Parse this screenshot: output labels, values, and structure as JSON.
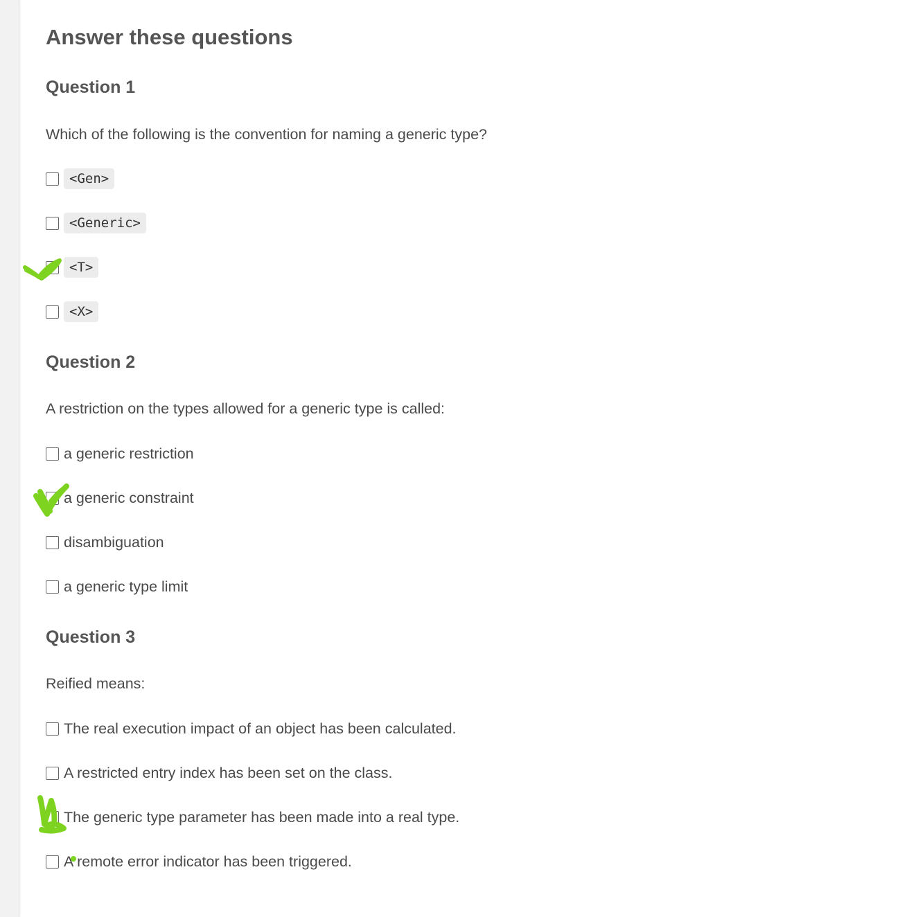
{
  "page": {
    "title": "Answer these questions"
  },
  "questions": [
    {
      "heading": "Question 1",
      "text": "Which of the following is the convention for naming a generic type?",
      "options": [
        {
          "label": "<Gen>",
          "style": "code",
          "checked": false
        },
        {
          "label": "<Generic>",
          "style": "code",
          "checked": false
        },
        {
          "label": "<T>",
          "style": "code",
          "checked": false
        },
        {
          "label": "<X>",
          "style": "code",
          "checked": false
        }
      ]
    },
    {
      "heading": "Question 2",
      "text": "A restriction on the types allowed for a generic type is called:",
      "options": [
        {
          "label": "a generic restriction",
          "style": "text",
          "checked": false
        },
        {
          "label": "a generic constraint",
          "style": "text",
          "checked": false
        },
        {
          "label": "disambiguation",
          "style": "text",
          "checked": false
        },
        {
          "label": "a generic type limit",
          "style": "text",
          "checked": false
        }
      ]
    },
    {
      "heading": "Question 3",
      "text": "Reified means:",
      "options": [
        {
          "label": "The real execution impact of an object has been calculated.",
          "style": "text",
          "checked": false
        },
        {
          "label": "A restricted entry index has been set on the class.",
          "style": "text",
          "checked": false
        },
        {
          "label": "The generic type parameter has been made into a real type.",
          "style": "text",
          "checked": false
        },
        {
          "label": "A remote error indicator has been triggered.",
          "style": "text",
          "checked": false
        }
      ]
    }
  ],
  "annotations": {
    "color": "#7ed321",
    "marks": [
      "checkmark-q1-option3",
      "checkmark-q2-option2",
      "scribble-q3-option3",
      "dot-q3-option4"
    ]
  }
}
